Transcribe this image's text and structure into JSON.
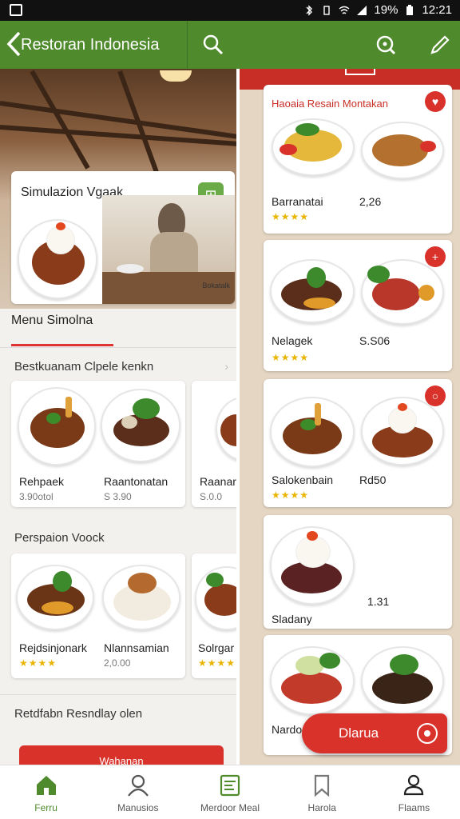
{
  "status_bar": {
    "battery": "19%",
    "time": "12:21"
  },
  "appbar": {
    "title": "Restoran Indonesia",
    "back_icon": "chevron-left-icon",
    "search_icon": "search-icon",
    "zoom_icon": "zoom-icon",
    "edit_icon": "pencil-icon"
  },
  "left_panel": {
    "sim_card": {
      "title": "Simulazion Vgaak",
      "photo_label": "Bokatalk"
    },
    "menu_title": "Menu Simolna",
    "section1": {
      "title": "Bestkuanam Clpele kenkn",
      "cards": [
        {
          "name": "Rehpaek",
          "price": "3.90otol",
          "name2": "Raantonatan",
          "price2": "S 3.90"
        },
        {
          "name": "Raanar",
          "price": "S.0.0"
        }
      ]
    },
    "section2": {
      "title": "Perspaion Voock",
      "cards": [
        {
          "name": "Rejdsinjonark",
          "stars": "★★★★",
          "name2": "Nlannsamian",
          "price2": "2,0.00"
        },
        {
          "name": "Solrgar",
          "stars": "★★★★"
        }
      ]
    },
    "section3": {
      "title": "Retdfabn Resndlay olen"
    },
    "bottom_button": "Wahanan"
  },
  "right_panel": {
    "header": "Haoaia Resain Montakan",
    "cards": [
      {
        "name": "Barranatai",
        "price": "2,26",
        "stars": "★★★★"
      },
      {
        "name": "Nelagek",
        "price": "S.S06",
        "stars": "★★★★"
      },
      {
        "name": "Salokenbain",
        "price": "Rd50",
        "stars": "★★★★"
      },
      {
        "name": "Sladany",
        "price": "1.31"
      },
      {
        "name": "Nardo"
      }
    ]
  },
  "fab": {
    "label": "Dlarua"
  },
  "bottom_nav": [
    {
      "label": "Ferru",
      "icon": "home-icon",
      "active": true
    },
    {
      "label": "Manusios",
      "icon": "person-icon",
      "active": false
    },
    {
      "label": "Merdoor Meal",
      "icon": "menu-board-icon",
      "active": false
    },
    {
      "label": "Harola",
      "icon": "bookmark-icon",
      "active": false
    },
    {
      "label": "Flaams",
      "icon": "profile-icon",
      "active": false
    }
  ],
  "colors": {
    "primary_green": "#4f8a2c",
    "accent_red": "#d8322b",
    "star": "#e9b500"
  }
}
